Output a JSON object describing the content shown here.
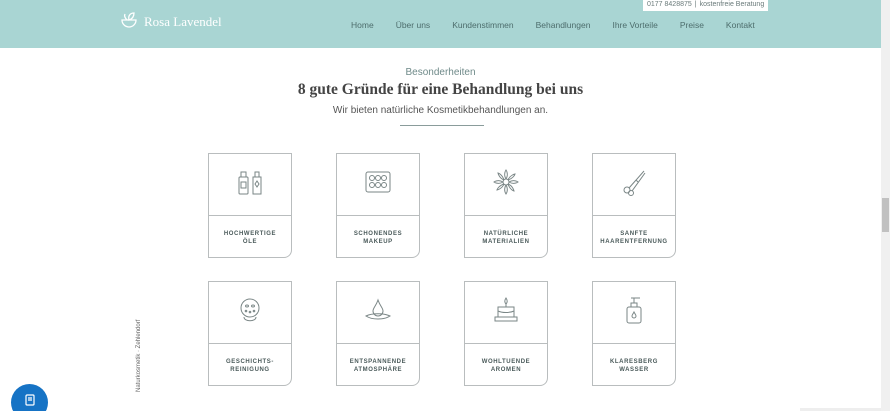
{
  "header": {
    "brand_name": "Rosa Lavendel",
    "phone": "0177 8428875",
    "separator": "|",
    "consult": "kostenfreie Beratung",
    "nav": [
      {
        "label": "Home"
      },
      {
        "label": "Über uns"
      },
      {
        "label": "Kundenstimmen"
      },
      {
        "label": "Behandlungen"
      },
      {
        "label": "Ihre Vorteile"
      },
      {
        "label": "Preise"
      },
      {
        "label": "Kontakt"
      }
    ]
  },
  "section": {
    "eyebrow": "Besonderheiten",
    "title": "8 gute Gründe für eine Behandlung bei uns",
    "subtitle": "Wir bieten natürliche Kosmetikbehandlungen an."
  },
  "cards": [
    {
      "line1": "HOCHWERTIGE",
      "line2": "ÖLE",
      "icon": "bottles-icon"
    },
    {
      "line1": "SCHONENDES",
      "line2": "MAKEUP",
      "icon": "makeup-palette-icon"
    },
    {
      "line1": "NATÜRLICHE",
      "line2": "MATERIALIEN",
      "icon": "flower-icon"
    },
    {
      "line1": "SANFTE",
      "line2": "HAARENTFERNUNG",
      "icon": "tweezers-icon"
    },
    {
      "line1": "GESCHICHTS-",
      "line2": "REINIGUNG",
      "icon": "face-mask-icon"
    },
    {
      "line1": "ENTSPANNENDE",
      "line2": "ATMOSPHÄRE",
      "icon": "water-drop-icon"
    },
    {
      "line1": "WOHLTUENDE",
      "line2": "AROMEN",
      "icon": "candle-icon"
    },
    {
      "line1": "KLARESBERG",
      "line2": "WASSER",
      "icon": "pump-bottle-icon"
    }
  ],
  "side_text": "Naturkosmetik · Zehlendorf",
  "colors": {
    "header_bg": "#a9d5d3",
    "chat_button": "#1673c5",
    "line": "#b9bdbe"
  }
}
